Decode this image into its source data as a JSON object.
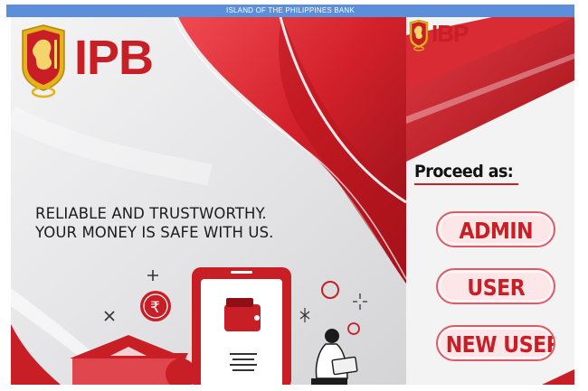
{
  "window": {
    "title": "ISLAND OF THE PHILIPPINES BANK"
  },
  "hero": {
    "brand": "IPB",
    "tagline_line1": "RELIABLE AND TRUSTWORTHY.",
    "tagline_line2": "YOUR MONEY IS SAFE WITH US.",
    "currency_symbol": "₹"
  },
  "side": {
    "brand": "IBP",
    "proceed_label": "Proceed as:",
    "buttons": {
      "admin": "ADMIN",
      "user": "USER",
      "new_user": "NEW USER"
    }
  },
  "colors": {
    "brand_red": "#c81e26",
    "title_bar_blue": "#5b8fd9",
    "logo_gold": "#e3b31b"
  }
}
